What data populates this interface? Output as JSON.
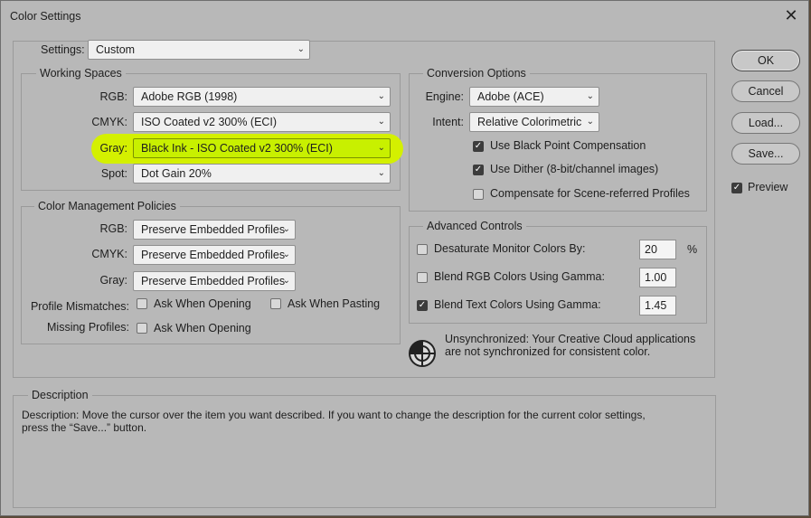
{
  "window": {
    "title": "Color Settings",
    "close_glyph": "✕"
  },
  "settings": {
    "label": "Settings:",
    "value": "Custom"
  },
  "working_spaces": {
    "legend": "Working Spaces",
    "rgb": {
      "label": "RGB:",
      "value": "Adobe RGB (1998)"
    },
    "cmyk": {
      "label": "CMYK:",
      "value": "ISO Coated v2 300% (ECI)"
    },
    "gray": {
      "label": "Gray:",
      "value": "Black Ink - ISO Coated v2 300% (ECI)",
      "highlight_color": "#c8f000"
    },
    "spot": {
      "label": "Spot:",
      "value": "Dot Gain 20%"
    }
  },
  "policies": {
    "legend": "Color Management Policies",
    "rgb": {
      "label": "RGB:",
      "value": "Preserve Embedded Profiles"
    },
    "cmyk": {
      "label": "CMYK:",
      "value": "Preserve Embedded Profiles"
    },
    "gray": {
      "label": "Gray:",
      "value": "Preserve Embedded Profiles"
    },
    "mismatches": {
      "label": "Profile Mismatches:",
      "ask_opening": "Ask When Opening",
      "ask_pasting": "Ask When Pasting"
    },
    "missing": {
      "label": "Missing Profiles:",
      "ask_opening": "Ask When Opening"
    }
  },
  "conversion": {
    "legend": "Conversion Options",
    "engine": {
      "label": "Engine:",
      "value": "Adobe (ACE)"
    },
    "intent": {
      "label": "Intent:",
      "value": "Relative Colorimetric"
    },
    "black_point": {
      "label": "Use Black Point Compensation",
      "checked": true
    },
    "dither": {
      "label": "Use Dither (8-bit/channel images)",
      "checked": true
    },
    "scene_referred": {
      "label": "Compensate for Scene-referred Profiles",
      "checked": false
    }
  },
  "advanced": {
    "legend": "Advanced Controls",
    "desaturate": {
      "label": "Desaturate Monitor Colors By:",
      "value": "20",
      "unit": "%",
      "checked": false
    },
    "blend_rgb": {
      "label": "Blend RGB Colors Using Gamma:",
      "value": "1.00",
      "checked": false
    },
    "blend_text": {
      "label": "Blend Text Colors Using Gamma:",
      "value": "1.45",
      "checked": true
    }
  },
  "sync": {
    "line1": "Unsynchronized: Your Creative Cloud applications",
    "line2": "are not synchronized for consistent color."
  },
  "description": {
    "legend": "Description",
    "line1": "Description:  Move the cursor over the item you want described.  If you want to change the description for the current color settings,",
    "line2": "press the “Save...” button."
  },
  "buttons": {
    "ok": "OK",
    "cancel": "Cancel",
    "load": "Load...",
    "save": "Save..."
  },
  "preview": {
    "label": "Preview",
    "checked": true
  },
  "glyphs": {
    "chevron": "⌄",
    "check": "✓"
  }
}
